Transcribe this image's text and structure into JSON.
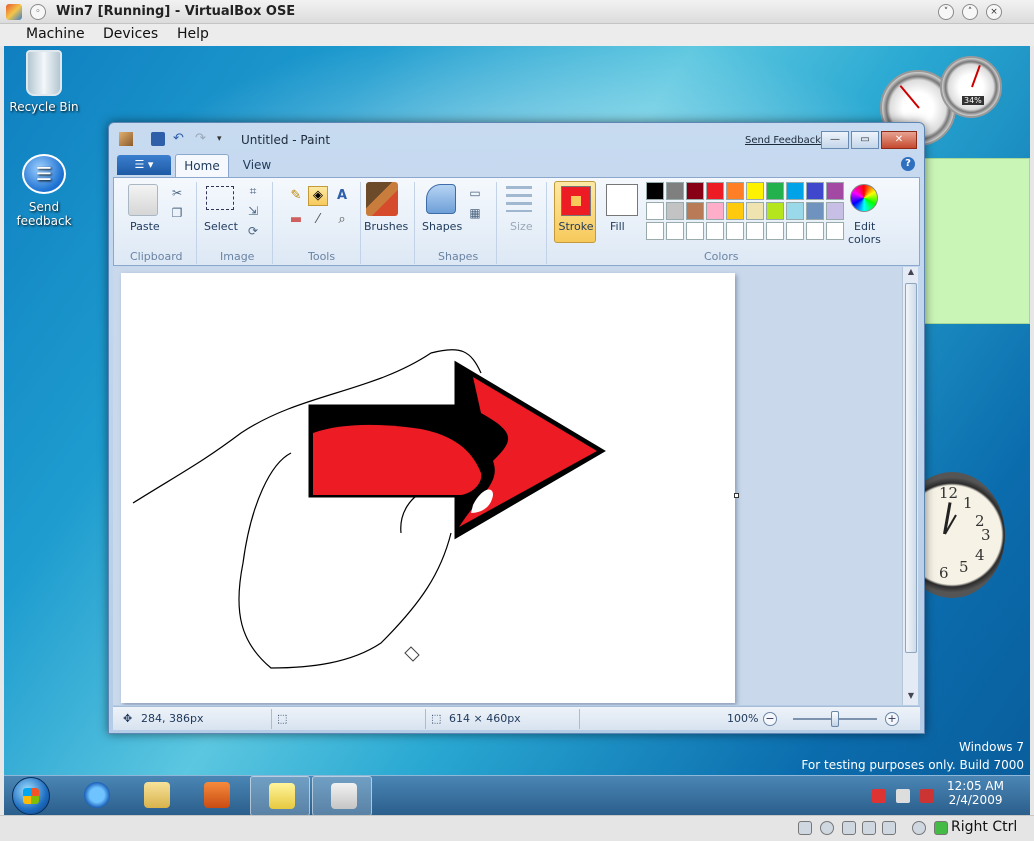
{
  "host": {
    "title": "Win7 [Running] - VirtualBox OSE",
    "menu": [
      "Machine",
      "Devices",
      "Help"
    ],
    "status_right": "Right Ctrl"
  },
  "desktop": {
    "icons": [
      {
        "label": "Recycle Bin"
      },
      {
        "label_line1": "Send",
        "label_line2": "feedback"
      }
    ],
    "watermark_line1": "Windows 7",
    "watermark_line2": "For testing purposes only. Build 7000",
    "gadgets": {
      "cpu_meter_percent": "34%"
    },
    "clock_numbers": [
      "12",
      "1",
      "2",
      "3",
      "4",
      "5",
      "6"
    ]
  },
  "taskbar": {
    "time": "12:05 AM",
    "date": "2/4/2009"
  },
  "paint": {
    "title": "Untitled - Paint",
    "send_feedback": "Send Feedback",
    "tabs": [
      "Home",
      "View"
    ],
    "ribbon": {
      "paste": "Paste",
      "select": "Select",
      "brushes": "Brushes",
      "shapes": "Shapes",
      "size": "Size",
      "stroke": "Stroke",
      "fill": "Fill",
      "edit_colors_1": "Edit",
      "edit_colors_2": "colors",
      "groups": [
        "Clipboard",
        "Image",
        "Tools",
        "Shapes",
        "Colors"
      ],
      "palette_row1": [
        "#000000",
        "#7f7f7f",
        "#880015",
        "#ed1c24",
        "#ff7f27",
        "#fff200",
        "#22b14c",
        "#00a2e8",
        "#3f48cc",
        "#a349a4"
      ],
      "palette_row2": [
        "#ffffff",
        "#c3c3c3",
        "#b97a57",
        "#ffaec9",
        "#ffc90e",
        "#efe4b0",
        "#b5e61d",
        "#99d9ea",
        "#7092be",
        "#c8bfe7"
      ]
    },
    "status": {
      "cursor_pos": "284, 386px",
      "canvas_size": "614 × 460px",
      "zoom": "100%"
    }
  }
}
